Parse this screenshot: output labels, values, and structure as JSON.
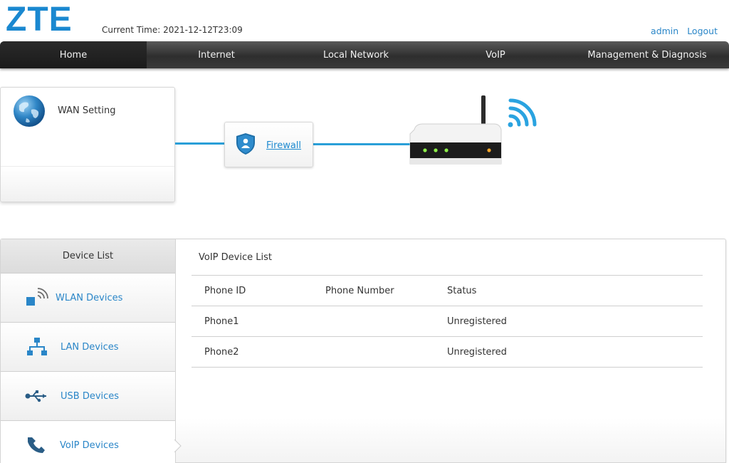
{
  "header": {
    "logo": "ZTE",
    "current_time_label": "Current Time:",
    "current_time_value": "2021-12-12T23:09",
    "user": "admin",
    "logout": "Logout"
  },
  "nav": {
    "items": [
      "Home",
      "Internet",
      "Local Network",
      "VoIP",
      "Management & Diagnosis"
    ],
    "active": "Home"
  },
  "topology": {
    "wan_label": "WAN Setting",
    "firewall_label": "Firewall"
  },
  "sidebar": {
    "title": "Device List",
    "items": [
      {
        "label": "WLAN Devices",
        "icon": "wifi-device-icon"
      },
      {
        "label": "LAN Devices",
        "icon": "lan-network-icon"
      },
      {
        "label": "USB Devices",
        "icon": "usb-icon"
      },
      {
        "label": "VoIP Devices",
        "icon": "phone-icon"
      }
    ],
    "selected": "VoIP Devices"
  },
  "voip": {
    "title": "VoIP Device List",
    "columns": [
      "Phone ID",
      "Phone Number",
      "Status"
    ],
    "rows": [
      {
        "id": "Phone1",
        "number": "",
        "status": "Unregistered"
      },
      {
        "id": "Phone2",
        "number": "",
        "status": "Unregistered"
      }
    ]
  },
  "colors": {
    "brand": "#1a88d0",
    "link": "#2a86c8",
    "line": "#2a9fd8",
    "nav_bg": "#3a3a3a"
  }
}
